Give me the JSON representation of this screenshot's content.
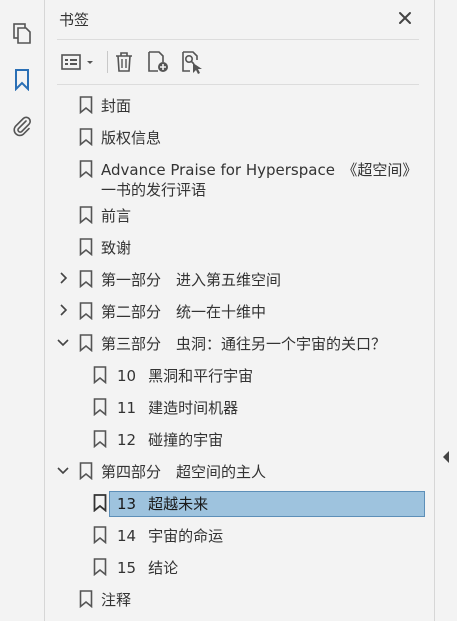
{
  "panel": {
    "title": "书签"
  },
  "rail": {
    "items": [
      {
        "icon": "pages-icon"
      },
      {
        "icon": "bookmark-icon"
      },
      {
        "icon": "attachment-icon"
      }
    ]
  },
  "toolbar": {
    "options_icon": "list-options-icon",
    "delete_icon": "trash-icon",
    "new_bookmark_icon": "new-bookmark-icon",
    "bookmark_from_structure_icon": "bookmark-search-icon"
  },
  "bookmarks": [
    {
      "label": "封面",
      "level": 0,
      "expandable": false
    },
    {
      "label": "版权信息",
      "level": 0,
      "expandable": false
    },
    {
      "label": "Advance Praise for Hyperspace　《超空间》一书的发行评语",
      "level": 0,
      "expandable": false
    },
    {
      "label": "前言",
      "level": 0,
      "expandable": false
    },
    {
      "label": "致谢",
      "level": 0,
      "expandable": false
    },
    {
      "label": "第一部分　进入第五维空间",
      "level": 0,
      "expandable": true,
      "expanded": false
    },
    {
      "label": "第二部分　统一在十维中",
      "level": 0,
      "expandable": true,
      "expanded": false
    },
    {
      "label": "第三部分　虫洞：通往另一个宇宙的关口？",
      "level": 0,
      "expandable": true,
      "expanded": true
    },
    {
      "num": "10",
      "label": "黑洞和平行宇宙",
      "level": 1
    },
    {
      "num": "11",
      "label": "建造时间机器",
      "level": 1
    },
    {
      "num": "12",
      "label": "碰撞的宇宙",
      "level": 1
    },
    {
      "label": "第四部分　超空间的主人",
      "level": 0,
      "expandable": true,
      "expanded": true
    },
    {
      "num": "13",
      "label": "超越未来",
      "level": 1,
      "selected": true
    },
    {
      "num": "14",
      "label": "宇宙的命运",
      "level": 1
    },
    {
      "num": "15",
      "label": "结论",
      "level": 1
    },
    {
      "label": "注释",
      "level": 0,
      "expandable": false
    }
  ],
  "colors": {
    "accent": "#2a6fb5",
    "selection_bg": "#9ec3de",
    "selection_border": "#5d8fb8"
  }
}
